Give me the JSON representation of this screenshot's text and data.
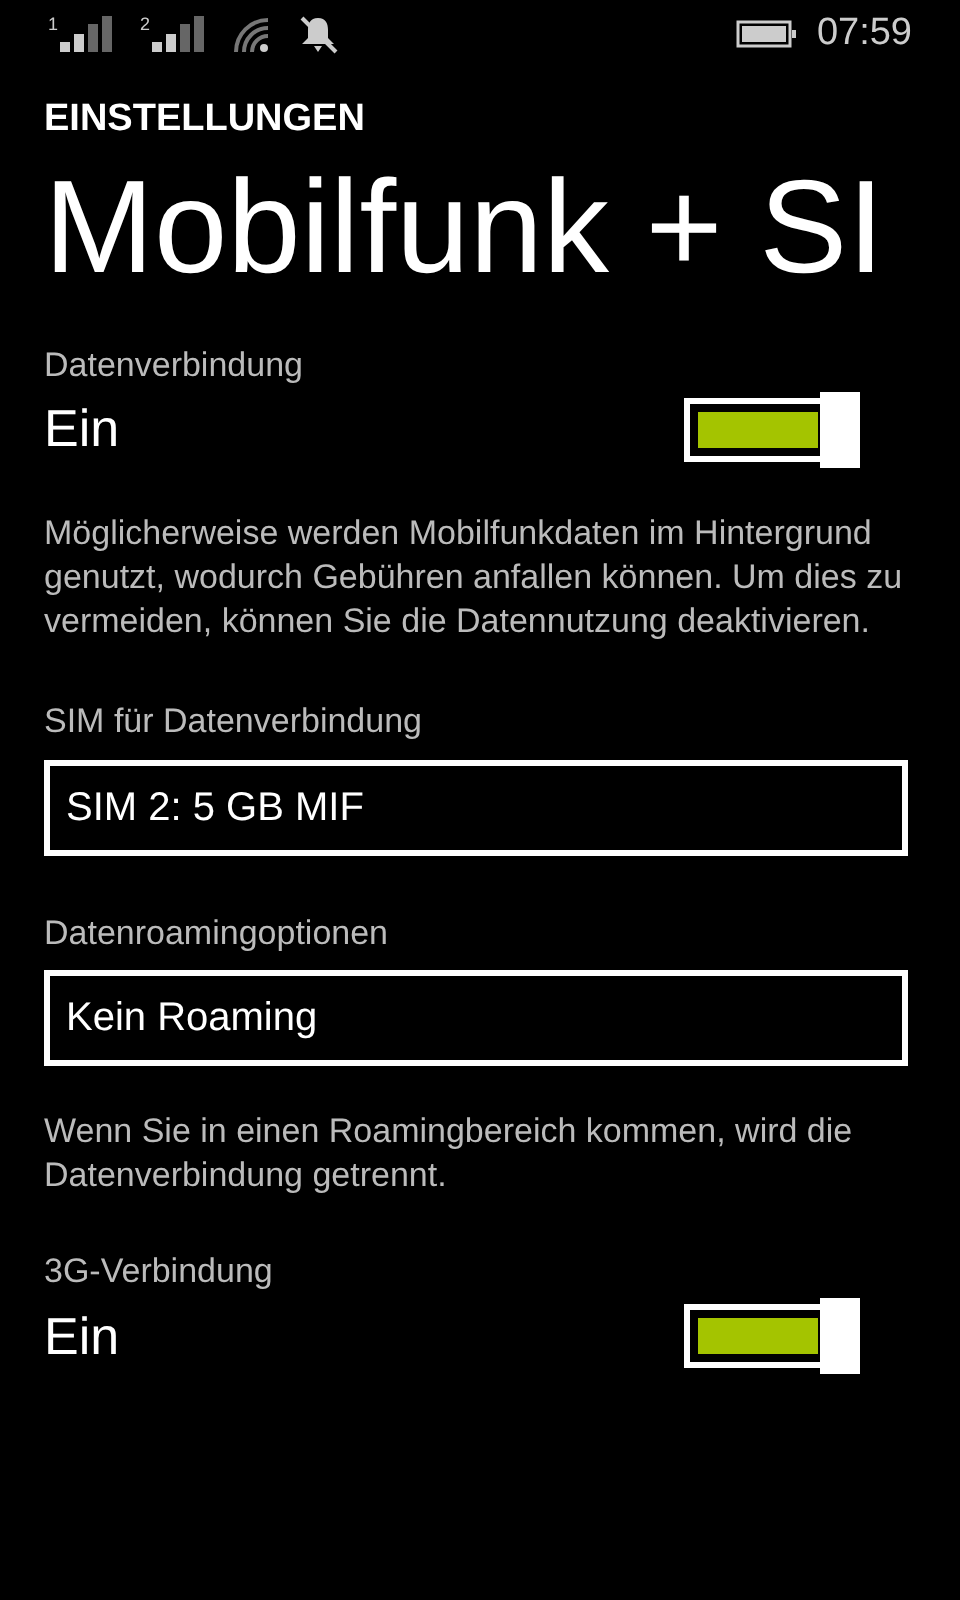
{
  "status_bar": {
    "sim_labels": [
      "1",
      "2"
    ],
    "time": "07:59"
  },
  "header": {
    "section": "EINSTELLUNGEN",
    "title": "Mobilfunk + SI"
  },
  "items": [
    {
      "kind": "toggle",
      "label": "Datenverbindung",
      "value": "Ein",
      "on": true
    },
    {
      "kind": "note",
      "text": "Möglicherweise werden Mobilfunkdaten im Hintergrund genutzt, wodurch Gebühren anfallen können. Um dies zu vermeiden, können Sie die Datennutzung deaktivieren."
    },
    {
      "kind": "select",
      "label": "SIM für Datenverbindung",
      "value": "SIM 2: 5 GB MIF"
    },
    {
      "kind": "select",
      "label": "Datenroamingoptionen",
      "value": "Kein Roaming"
    },
    {
      "kind": "note",
      "text": "Wenn Sie in einen Roamingbereich kommen, wird die Datenverbindung getrennt."
    },
    {
      "kind": "toggle",
      "label": "3G-Verbindung",
      "value": "Ein",
      "on": true
    }
  ]
}
